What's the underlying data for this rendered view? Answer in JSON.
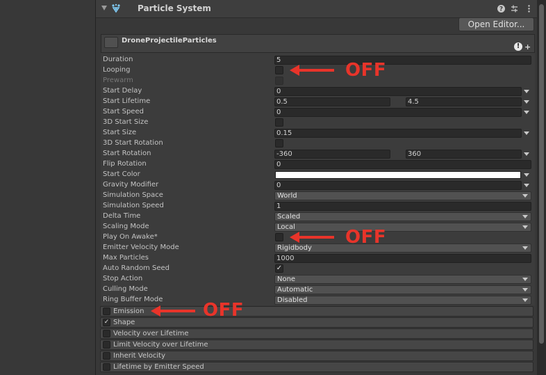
{
  "component": {
    "title": "Particle System",
    "open_editor_label": "Open Editor...",
    "icons": [
      "help-icon",
      "presets-icon",
      "more-icon"
    ]
  },
  "particle_system": {
    "name": "DroneProjectileParticles",
    "alert_glyph": "!",
    "add_glyph": "+"
  },
  "properties": [
    {
      "label": "Duration",
      "kind": "field",
      "value": "5"
    },
    {
      "label": "Looping",
      "kind": "checkbox",
      "checked": false
    },
    {
      "label": "Prewarm",
      "kind": "checkbox",
      "checked": false,
      "disabled": true
    },
    {
      "label": "Start Delay",
      "kind": "field-arrow",
      "value": "0"
    },
    {
      "label": "Start Lifetime",
      "kind": "range",
      "min": "0.5",
      "max": "4.5"
    },
    {
      "label": "Start Speed",
      "kind": "field-arrow",
      "value": "0"
    },
    {
      "label": "3D Start Size",
      "kind": "checkbox",
      "checked": false
    },
    {
      "label": "Start Size",
      "kind": "field-arrow",
      "value": "0.15"
    },
    {
      "label": "3D Start Rotation",
      "kind": "checkbox",
      "checked": false
    },
    {
      "label": "Start Rotation",
      "kind": "range",
      "min": "-360",
      "max": "360"
    },
    {
      "label": "Flip Rotation",
      "kind": "field",
      "value": "0"
    },
    {
      "label": "Start Color",
      "kind": "color",
      "value": "#ffffff"
    },
    {
      "label": "Gravity Modifier",
      "kind": "field-arrow",
      "value": "0"
    },
    {
      "label": "Simulation Space",
      "kind": "dropdown",
      "value": "World"
    },
    {
      "label": "Simulation Speed",
      "kind": "field",
      "value": "1"
    },
    {
      "label": "Delta Time",
      "kind": "dropdown",
      "value": "Scaled"
    },
    {
      "label": "Scaling Mode",
      "kind": "dropdown",
      "value": "Local"
    },
    {
      "label": "Play On Awake*",
      "kind": "checkbox",
      "checked": false
    },
    {
      "label": "Emitter Velocity Mode",
      "kind": "dropdown",
      "value": "Rigidbody"
    },
    {
      "label": "Max Particles",
      "kind": "field",
      "value": "1000"
    },
    {
      "label": "Auto Random Seed",
      "kind": "checkbox",
      "checked": true
    },
    {
      "label": "Stop Action",
      "kind": "dropdown",
      "value": "None"
    },
    {
      "label": "Culling Mode",
      "kind": "dropdown",
      "value": "Automatic"
    },
    {
      "label": "Ring Buffer Mode",
      "kind": "dropdown",
      "value": "Disabled"
    }
  ],
  "modules": [
    {
      "label": "Emission",
      "checked": false
    },
    {
      "label": "Shape",
      "checked": true
    },
    {
      "label": "Velocity over Lifetime",
      "checked": false
    },
    {
      "label": "Limit Velocity over Lifetime",
      "checked": false
    },
    {
      "label": "Inherit Velocity",
      "checked": false
    },
    {
      "label": "Lifetime by Emitter Speed",
      "checked": false
    }
  ],
  "annotations": [
    {
      "text": "OFF",
      "target": "Looping"
    },
    {
      "text": "OFF",
      "target": "Play On Awake*"
    },
    {
      "text": "OFF",
      "target": "Emission"
    }
  ],
  "colors": {
    "annotation": "#e8342a",
    "panel_bg": "#383838",
    "field_bg": "#2a2a2a"
  }
}
